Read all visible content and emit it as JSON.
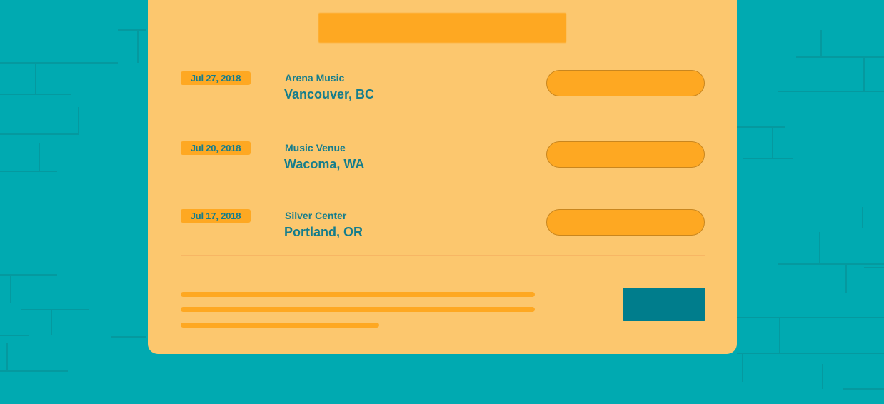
{
  "colors": {
    "background": "#00aab1",
    "background_lines": "#05999f",
    "card": "#fcc76e",
    "accent": "#fea822",
    "text": "#157d8c",
    "divider": "#f2a85c",
    "submit_button": "#007d8c"
  },
  "events": [
    {
      "date": "Jul 27, 2018",
      "venue": "Arena Music",
      "city": "Vancouver, BC",
      "ticket_button_label": ""
    },
    {
      "date": "Jul 20, 2018",
      "venue": "Music Venue",
      "city": "Wacoma, WA",
      "ticket_button_label": ""
    },
    {
      "date": "Jul 17, 2018",
      "venue": "Silver Center",
      "city": "Portland, OR",
      "ticket_button_label": ""
    }
  ],
  "footer": {
    "submit_label": ""
  }
}
